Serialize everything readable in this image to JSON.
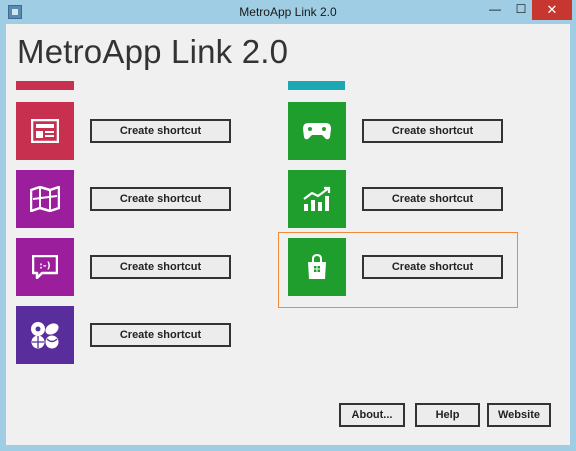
{
  "window": {
    "title": "MetroApp Link 2.0",
    "minimize_glyph": "—",
    "maximize_glyph": "☐",
    "close_glyph": "✕"
  },
  "main": {
    "heading": "MetroApp Link 2.0"
  },
  "groups": [
    {
      "accent": "#c8304f"
    },
    {
      "accent": "#1ba7b4"
    }
  ],
  "apps": [
    {
      "icon": "news-icon",
      "tile_color": "#c8304f",
      "button_label": "Create shortcut"
    },
    {
      "icon": "maps-icon",
      "tile_color": "#9b1f9c",
      "button_label": "Create shortcut"
    },
    {
      "icon": "messaging-icon",
      "tile_color": "#9b1f9c",
      "button_label": "Create shortcut"
    },
    {
      "icon": "sports-icon",
      "tile_color": "#5a2d9c",
      "button_label": "Create shortcut"
    },
    {
      "icon": "games-controller-icon",
      "tile_color": "#1f9e2e",
      "button_label": "Create shortcut"
    },
    {
      "icon": "finance-chart-icon",
      "tile_color": "#1f9e2e",
      "button_label": "Create shortcut"
    },
    {
      "icon": "store-bag-icon",
      "tile_color": "#1f9e2e",
      "button_label": "Create shortcut",
      "selected": true
    }
  ],
  "footer": {
    "about_label": "About...",
    "help_label": "Help",
    "website_label": "Website"
  },
  "colors": {
    "title_bar": "#9fcde4",
    "close_button": "#c7372f",
    "selection_border": "#f08a3c"
  }
}
